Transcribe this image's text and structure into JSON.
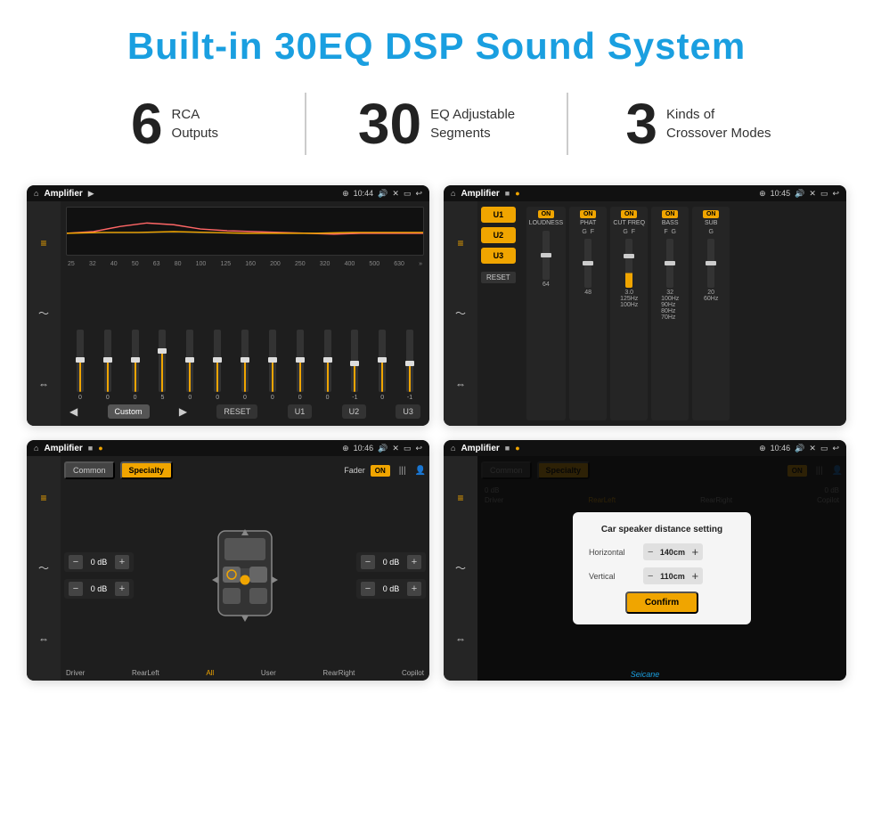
{
  "header": {
    "title": "Built-in 30EQ DSP Sound System"
  },
  "stats": [
    {
      "number": "6",
      "text_line1": "RCA",
      "text_line2": "Outputs"
    },
    {
      "number": "30",
      "text_line1": "EQ Adjustable",
      "text_line2": "Segments"
    },
    {
      "number": "3",
      "text_line1": "Kinds of",
      "text_line2": "Crossover Modes"
    }
  ],
  "screen1": {
    "status": {
      "title": "Amplifier",
      "time": "10:44"
    },
    "eq_labels": [
      "25",
      "32",
      "40",
      "50",
      "63",
      "80",
      "100",
      "125",
      "160",
      "200",
      "250",
      "320",
      "400",
      "500",
      "630"
    ],
    "eq_values": [
      "0",
      "0",
      "0",
      "5",
      "0",
      "0",
      "0",
      "0",
      "0",
      "0",
      "-1",
      "0",
      "-1"
    ],
    "bottom_btns": [
      "Custom",
      "RESET",
      "U1",
      "U2",
      "U3"
    ]
  },
  "screen2": {
    "status": {
      "title": "Amplifier",
      "time": "10:45"
    },
    "presets": [
      "U1",
      "U2",
      "U3"
    ],
    "modules": [
      {
        "on": true,
        "label": "LOUDNESS"
      },
      {
        "on": true,
        "label": "PHAT"
      },
      {
        "on": true,
        "label": "CUT FREQ"
      },
      {
        "on": true,
        "label": "BASS"
      },
      {
        "on": true,
        "label": "SUB"
      }
    ],
    "reset_label": "RESET"
  },
  "screen3": {
    "status": {
      "title": "Amplifier",
      "time": "10:46"
    },
    "tabs": [
      "Common",
      "Specialty"
    ],
    "fader_label": "Fader",
    "on_label": "ON",
    "channels": [
      {
        "val": "0 dB"
      },
      {
        "val": "0 dB"
      },
      {
        "val": "0 dB"
      },
      {
        "val": "0 dB"
      }
    ],
    "bottom_labels": [
      "Driver",
      "RearLeft",
      "All",
      "User",
      "RearRight",
      "Copilot"
    ]
  },
  "screen4": {
    "status": {
      "title": "Amplifier",
      "time": "10:46"
    },
    "tabs": [
      "Common",
      "Specialty"
    ],
    "dialog": {
      "title": "Car speaker distance setting",
      "horizontal_label": "Horizontal",
      "horizontal_value": "140cm",
      "vertical_label": "Vertical",
      "vertical_value": "110cm",
      "confirm_label": "Confirm"
    },
    "bottom_labels": [
      "Driver",
      "RearLeft",
      "RearRight",
      "Copilot"
    ]
  },
  "watermark": "Seicane"
}
